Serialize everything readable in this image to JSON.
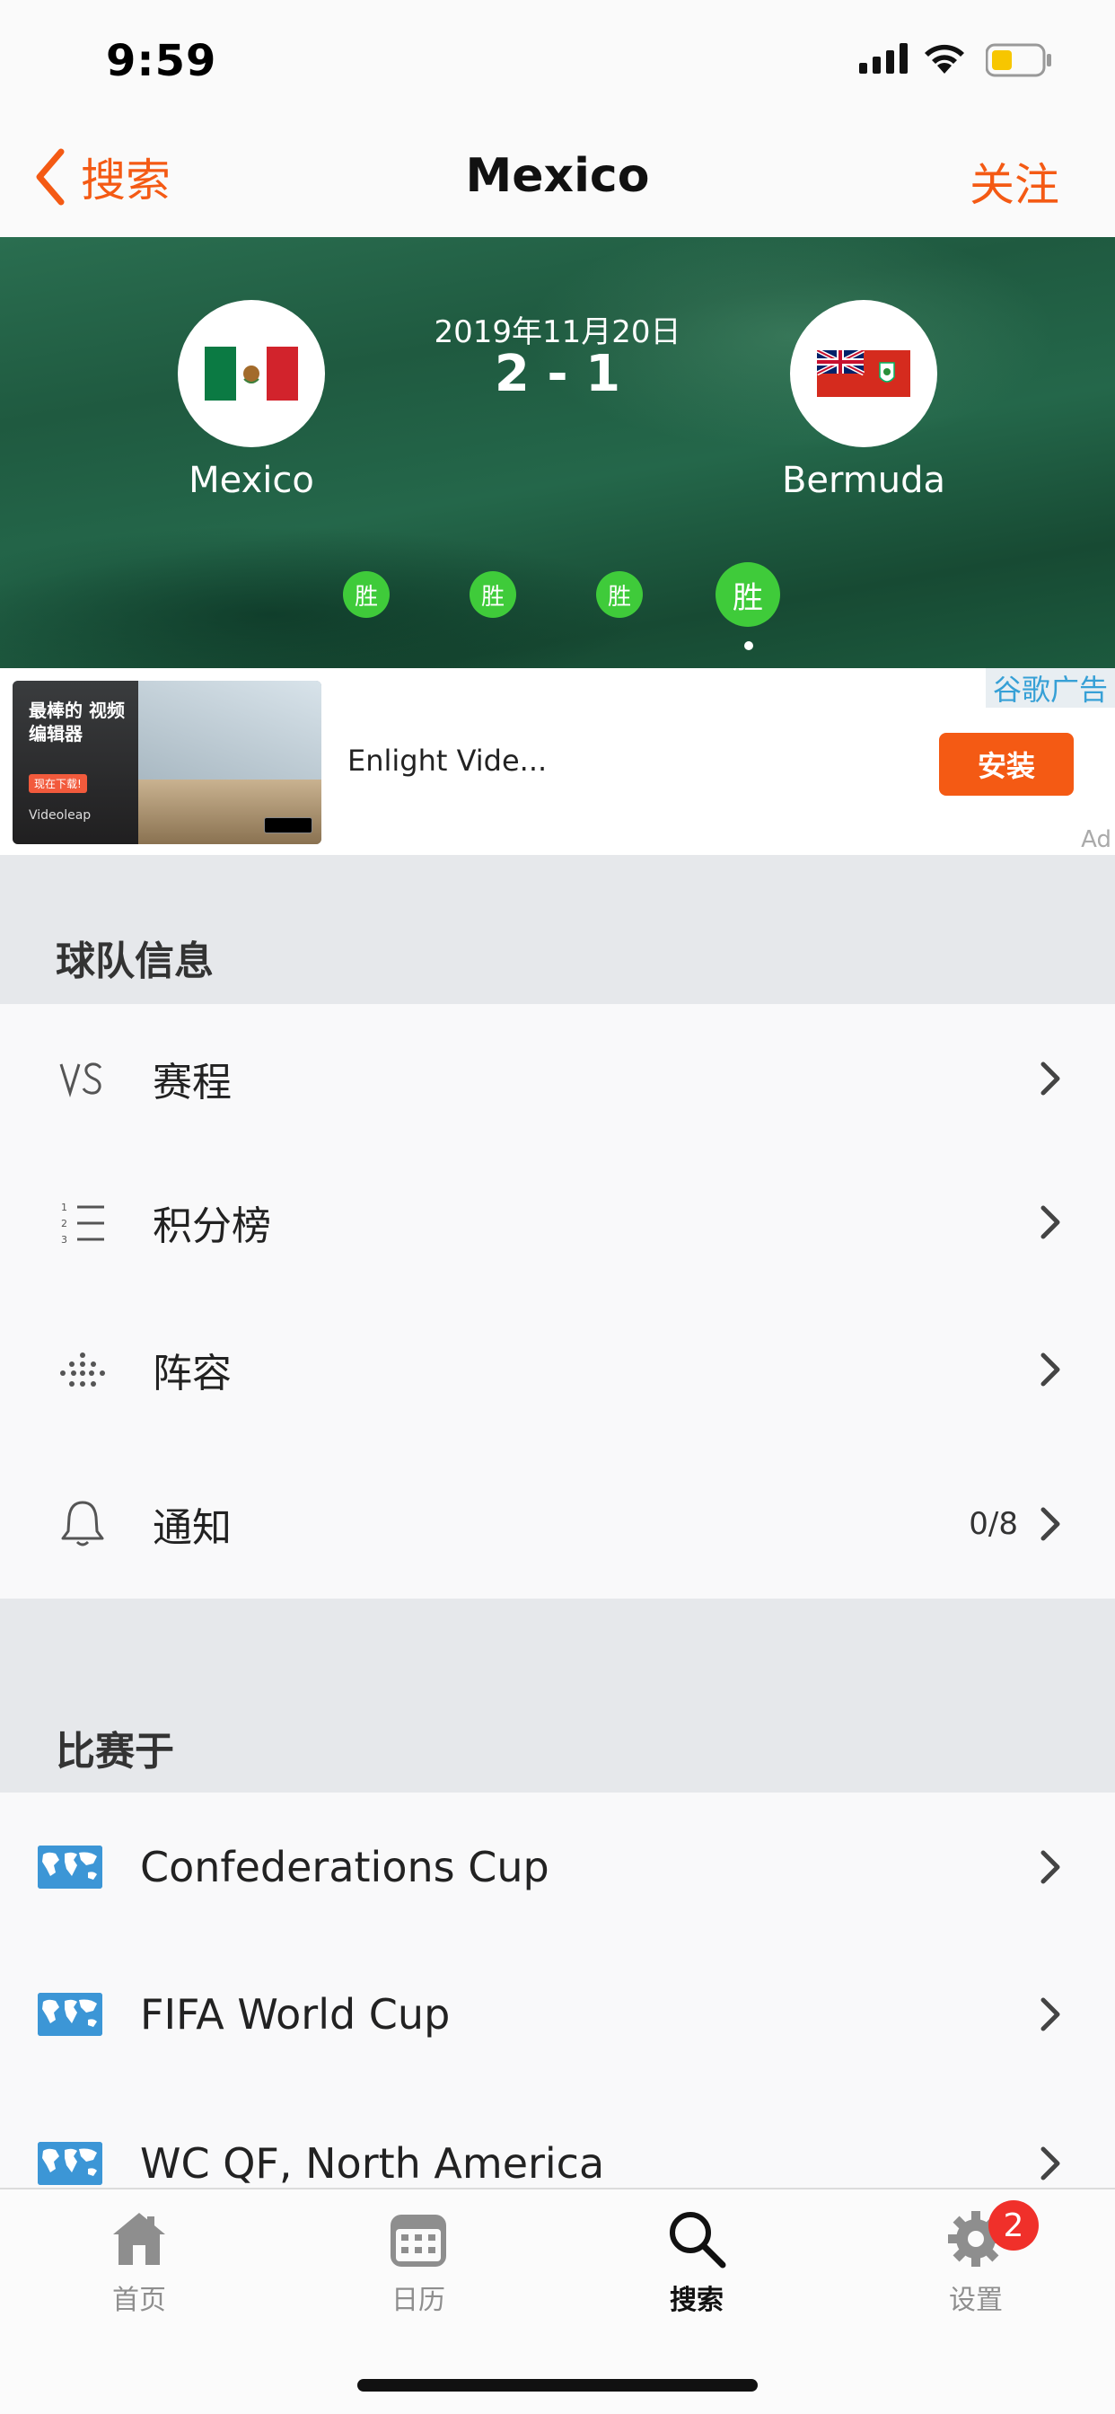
{
  "status_bar": {
    "time": "9:59"
  },
  "nav": {
    "back_label": "搜索",
    "title": "Mexico",
    "follow_label": "关注"
  },
  "match": {
    "date": "2019年11月20日",
    "score": "2 - 1",
    "home_team": "Mexico",
    "away_team": "Bermuda",
    "form": [
      "胜",
      "胜",
      "胜",
      "胜"
    ]
  },
  "ad": {
    "image_text": "最棒的 视频 编辑器",
    "image_chip": "现在下载!",
    "image_brand": "Videoleap",
    "title": "Enlight Vide...",
    "install_label": "安装",
    "google_label": "谷歌广告",
    "ad_label": "Ad"
  },
  "team_info": {
    "header": "球队信息",
    "items": [
      {
        "label": "赛程",
        "icon": "vs-icon",
        "value": ""
      },
      {
        "label": "积分榜",
        "icon": "standings-list-icon",
        "value": ""
      },
      {
        "label": "阵容",
        "icon": "lineup-dots-icon",
        "value": ""
      },
      {
        "label": "通知",
        "icon": "bell-icon",
        "value": "0/8"
      }
    ]
  },
  "competitions": {
    "header": "比赛于",
    "items": [
      {
        "label": "Confederations Cup",
        "icon": "world-map-icon"
      },
      {
        "label": "FIFA World Cup",
        "icon": "world-map-icon"
      },
      {
        "label": "WC QF, North America",
        "icon": "world-map-icon"
      }
    ]
  },
  "tabs": [
    {
      "label": "首页",
      "icon": "home-icon"
    },
    {
      "label": "日历",
      "icon": "calendar-icon"
    },
    {
      "label": "搜索",
      "icon": "search-icon",
      "active": true
    },
    {
      "label": "设置",
      "icon": "gear-icon",
      "badge": "2"
    }
  ],
  "colors": {
    "accent": "#f45a14",
    "win": "#3fcb3a",
    "badge": "#f0302a"
  }
}
